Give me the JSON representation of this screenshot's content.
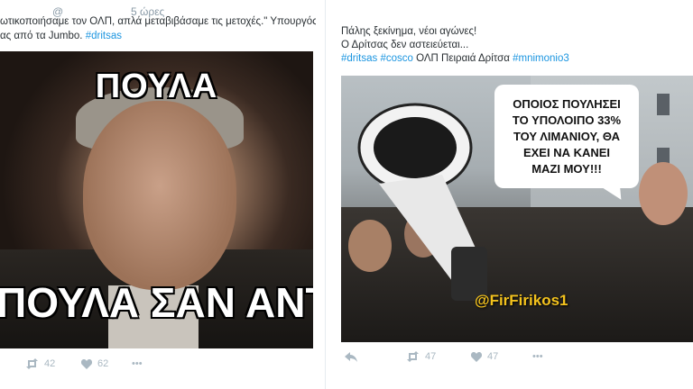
{
  "left_tweet": {
    "handle": "@",
    "time": "5 ώρες",
    "text_line1": "ωτικοποιήσαμε τον ΟΛΠ, απλά μεταβιβάσαμε τις μετοχές.\" Υπουργός",
    "text_line2_prefix": "ας από τα Jumbo.",
    "hashtag": "#dritsas",
    "meme_top": "ΠΟΥΛΑ",
    "meme_bottom": "ΠΟΥΛΑ ΣΑΝ ΑΝΤΡΑΣ",
    "retweets": "42",
    "likes": "62",
    "more": "•••"
  },
  "right_tweet": {
    "line1": "Πάλης ξεκίνημα, νέοι αγώνες!",
    "line2": "Ο Δρίτσας δεν αστειεύεται...",
    "hashtags": {
      "h1": "#dritsas",
      "h2": "#cosco",
      "plain": "ΟΛΠ Πειραιά Δρίτσα",
      "h3": "#mnimonio3"
    },
    "bubble_lines": [
      "ΟΠΟΙΟΣ ΠΟΥΛΗΣΕΙ",
      "ΤΟ ΥΠΟΛΟΙΠΟ 33%",
      "ΤΟΥ ΛΙΜΑΝΙΟΥ, ΘΑ",
      "ΕΧΕΙ ΝΑ ΚΑΝΕΙ",
      "ΜΑΖΙ ΜΟΥ!!!"
    ],
    "watermark": "@FirFirikos1",
    "retweets": "47",
    "likes": "47",
    "more": "•••"
  },
  "icons": {
    "reply": "reply-icon",
    "retweet": "retweet-icon",
    "like": "heart-icon",
    "more": "more-icon"
  },
  "colors": {
    "link": "#1b95e0",
    "muted": "#aab8c2",
    "text": "#292f33"
  }
}
